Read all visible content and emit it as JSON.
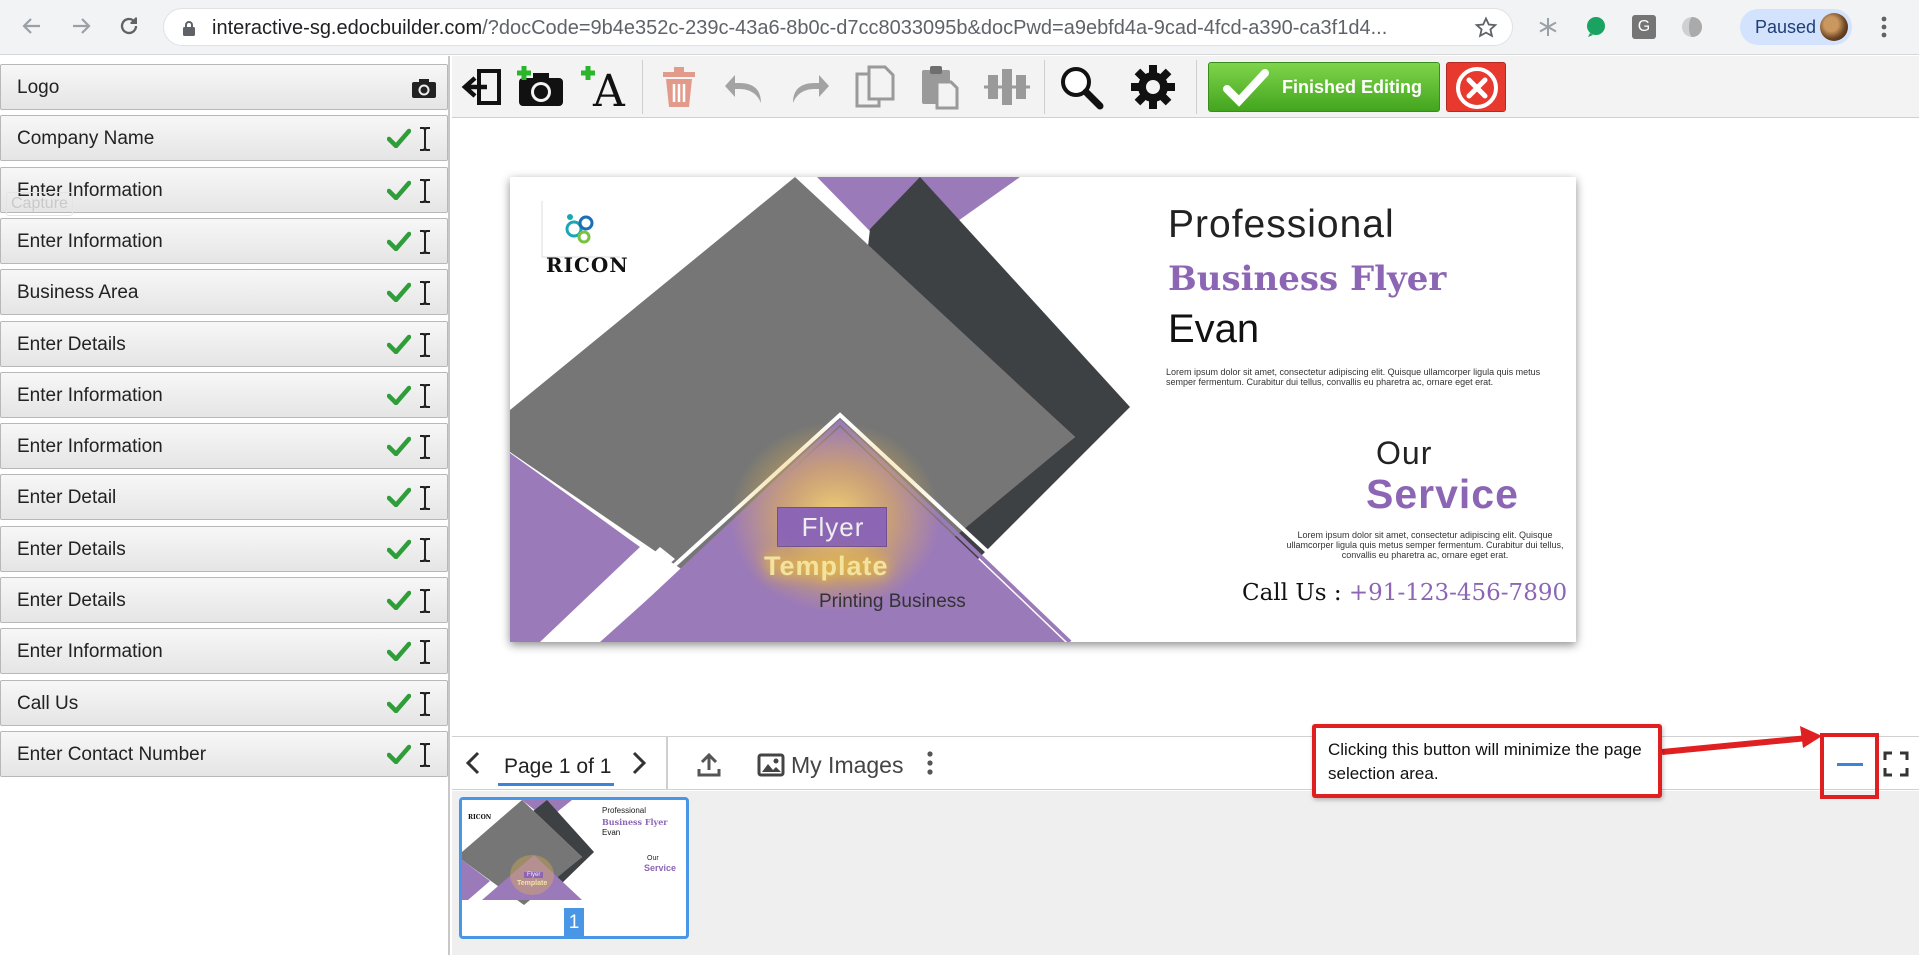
{
  "browser": {
    "url_host": "interactive-sg.edocbuilder.com",
    "url_path": "/?docCode=9b4e352c-239c-43a6-8b0c-d7cc8033095b&docPwd=a9ebfd4a-9cad-4fcd-a390-ca3f1d4...",
    "profile_status": "Paused",
    "extension_g_label": "G"
  },
  "left_panel": {
    "ghost_label": "Capture",
    "fields": [
      {
        "label": "Logo",
        "type": "image"
      },
      {
        "label": "Company Name",
        "type": "text"
      },
      {
        "label": "Enter Information",
        "type": "text"
      },
      {
        "label": "Enter Information",
        "type": "text"
      },
      {
        "label": "Business Area",
        "type": "text"
      },
      {
        "label": "Enter Details",
        "type": "text"
      },
      {
        "label": "Enter Information",
        "type": "text"
      },
      {
        "label": "Enter Information",
        "type": "text"
      },
      {
        "label": "Enter Detail",
        "type": "text"
      },
      {
        "label": "Enter Details",
        "type": "text"
      },
      {
        "label": "Enter Details",
        "type": "text"
      },
      {
        "label": "Enter Information",
        "type": "text"
      },
      {
        "label": "Call Us",
        "type": "text"
      },
      {
        "label": "Enter Contact Number",
        "type": "text"
      }
    ]
  },
  "toolbar": {
    "finish_label": "Finished Editing",
    "tools": [
      "exit-icon",
      "add-image-icon",
      "add-text-icon",
      "trash-icon",
      "undo-icon",
      "redo-icon",
      "copy-icon",
      "paste-icon",
      "align-icon",
      "zoom-icon",
      "settings-icon"
    ]
  },
  "flyer": {
    "logo_text": "RICON",
    "heading_professional": "Professional",
    "heading_business": "Business Flyer",
    "name": "Evan",
    "lorem_1": "Lorem ipsum dolor sit amet, consectetur adipiscing elit. Quisque ullamcorper ligula quis metus semper fermentum. Curabitur dui tellus, convallis eu pharetra ac, ornare eget erat.",
    "our": "Our",
    "service": "Service",
    "lorem_2": "Lorem ipsum dolor sit amet, consectetur adipiscing elit. Quisque ullamcorper ligula quis metus semper fermentum. Curabitur dui tellus, convallis eu pharetra ac, ornare eget erat.",
    "call_label": "Call Us : ",
    "call_number": "+91-123-456-7890",
    "flyer_word": "Flyer",
    "template_word": "Template",
    "printing": "Printing Business",
    "colors": {
      "purple": "#8c66b5",
      "dark": "#3e4144",
      "gray": "#777777"
    }
  },
  "page_bar": {
    "page_label": "Page 1 of 1",
    "my_images_label": "My Images",
    "thumbnail_number": "1"
  },
  "thumbnail": {
    "professional": "Professional",
    "business": "Business Flyer",
    "name": "Evan",
    "our": "Our",
    "service": "Service",
    "flyer_word": "Flyer",
    "template_word": "Template",
    "logo_text": "RICON"
  },
  "annotation": {
    "text": "Clicking this button will minimize the page selection area."
  }
}
